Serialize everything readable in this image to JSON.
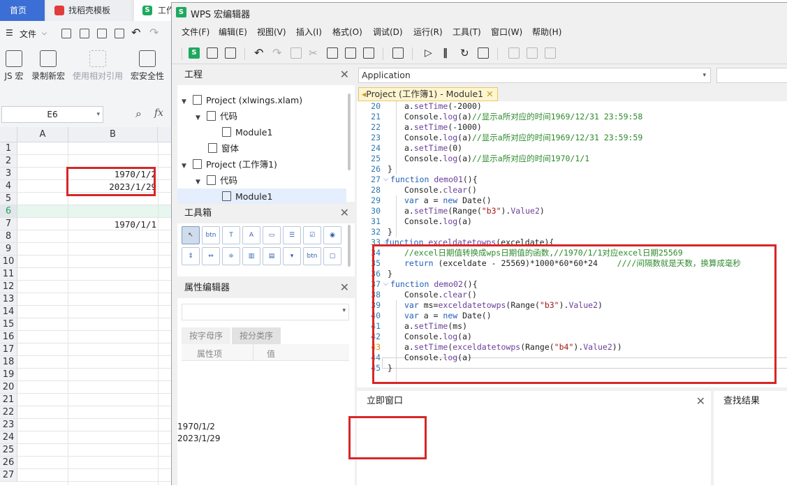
{
  "browser_tabs": [
    {
      "label": "首页"
    },
    {
      "label": "找稻壳模板"
    },
    {
      "label": "工作"
    }
  ],
  "sheet": {
    "file_menu": "文件",
    "ribbon": [
      {
        "label": "JS 宏"
      },
      {
        "label": "录制新宏"
      },
      {
        "label": "使用相对引用"
      },
      {
        "label": "宏安全性"
      }
    ],
    "name_box": "E6",
    "fx": "fx",
    "columns": [
      "A",
      "B"
    ],
    "rows": [
      "1",
      "2",
      "3",
      "4",
      "5",
      "6",
      "7",
      "8",
      "9",
      "10",
      "11",
      "12",
      "13",
      "14",
      "15",
      "16",
      "17",
      "18",
      "19",
      "20",
      "21",
      "22",
      "23",
      "24",
      "25",
      "26",
      "27"
    ],
    "cells": {
      "b3": "1970/1/2",
      "b4": "2023/1/29",
      "b7": "1970/1/1"
    }
  },
  "editor": {
    "title": "WPS 宏编辑器",
    "menu": [
      "文件(F)",
      "编辑(E)",
      "视图(V)",
      "插入(I)",
      "格式(O)",
      "调试(D)",
      "运行(R)",
      "工具(T)",
      "窗口(W)",
      "帮助(H)"
    ],
    "project_panel": {
      "title": "工程",
      "tree": [
        {
          "label": "Project (xlwings.xlam)"
        },
        {
          "label": "代码"
        },
        {
          "label": "Module1"
        },
        {
          "label": "窗体"
        },
        {
          "label": "Project (工作簿1)"
        },
        {
          "label": "代码"
        },
        {
          "label": "Module1"
        }
      ]
    },
    "toolbox_panel": {
      "title": "工具箱"
    },
    "properties_panel": {
      "title": "属性编辑器",
      "tabs": [
        "按字母序",
        "按分类序"
      ],
      "columns": [
        "属性项",
        "值"
      ]
    },
    "object_combo": "Application",
    "code_tab": "Project (工作簿1) - Module1",
    "code_lines": [
      {
        "n": "20",
        "text": "a.setTime(-2000)"
      },
      {
        "n": "21",
        "text": "Console.log(a)//显示a所对应的时间1969/12/31 23:59:58"
      },
      {
        "n": "22",
        "text": "a.setTime(-1000)"
      },
      {
        "n": "23",
        "text": "Console.log(a)//显示a所对应的时间1969/12/31 23:59:59"
      },
      {
        "n": "24",
        "text": "a.setTime(0)"
      },
      {
        "n": "25",
        "text": "Console.log(a)//显示a所对应的时间1970/1/1"
      },
      {
        "n": "26",
        "text": "}"
      },
      {
        "n": "27",
        "text": "function demo01(){"
      },
      {
        "n": "28",
        "text": "Console.clear()"
      },
      {
        "n": "29",
        "text": "var a = new Date()"
      },
      {
        "n": "30",
        "text": "a.setTime(Range(\"b3\").Value2)"
      },
      {
        "n": "31",
        "text": "Console.log(a)"
      },
      {
        "n": "32",
        "text": "}"
      },
      {
        "n": "33",
        "text": "function exceldatetowps(exceldate){"
      },
      {
        "n": "34",
        "text": "//excel日期值转换成wps日期值的函数,//1970/1/1对应excel日期25569"
      },
      {
        "n": "35",
        "text": "return (exceldate - 25569)*1000*60*60*24    ////间隔数就是天数，换算成毫秒"
      },
      {
        "n": "36",
        "text": "}"
      },
      {
        "n": "37",
        "text": "function demo02(){"
      },
      {
        "n": "38",
        "text": "Console.clear()"
      },
      {
        "n": "39",
        "text": "var ms=exceldatetowps(Range(\"b3\").Value2)"
      },
      {
        "n": "40",
        "text": "var a = new Date()"
      },
      {
        "n": "41",
        "text": "a.setTime(ms)"
      },
      {
        "n": "42",
        "text": "Console.log(a)"
      },
      {
        "n": "43",
        "text": "a.setTime(exceldatetowps(Range(\"b4\").Value2))"
      },
      {
        "n": "44",
        "text": "Console.log(a)"
      },
      {
        "n": "45",
        "text": "}"
      }
    ],
    "immediate": {
      "title": "立即窗口",
      "output": [
        "1970/1/2",
        "2023/1/29"
      ]
    },
    "find_results": {
      "title": "查找结果"
    }
  },
  "colors": {
    "highlight_box": "#d82626",
    "accent": "#1ea860",
    "keyword": "#1f5fb8",
    "comment": "#2d8a2d",
    "string": "#a31515"
  }
}
